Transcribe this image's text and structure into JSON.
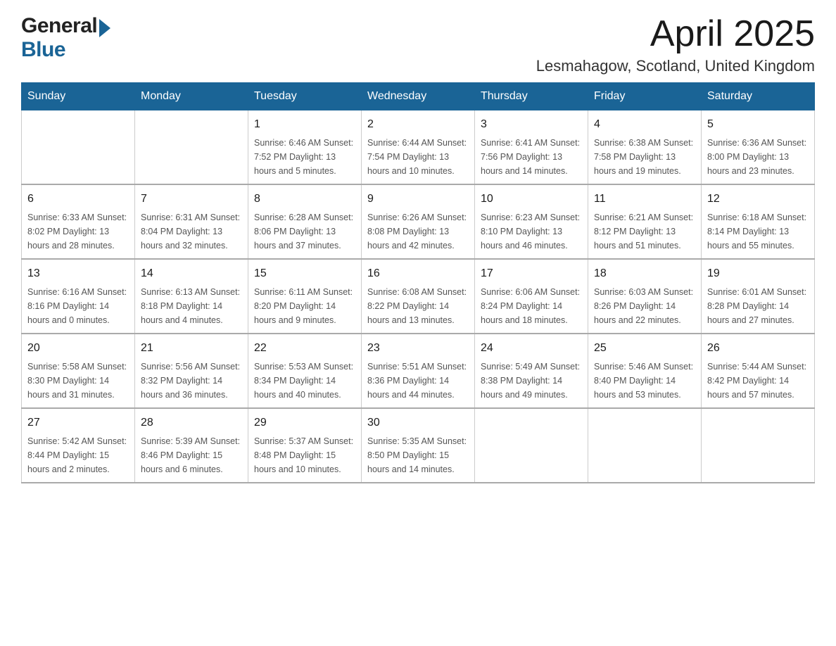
{
  "header": {
    "title": "April 2025",
    "subtitle": "Lesmahagow, Scotland, United Kingdom",
    "logo_general": "General",
    "logo_blue": "Blue"
  },
  "calendar": {
    "days": [
      "Sunday",
      "Monday",
      "Tuesday",
      "Wednesday",
      "Thursday",
      "Friday",
      "Saturday"
    ],
    "weeks": [
      [
        {
          "num": "",
          "info": ""
        },
        {
          "num": "",
          "info": ""
        },
        {
          "num": "1",
          "info": "Sunrise: 6:46 AM\nSunset: 7:52 PM\nDaylight: 13 hours\nand 5 minutes."
        },
        {
          "num": "2",
          "info": "Sunrise: 6:44 AM\nSunset: 7:54 PM\nDaylight: 13 hours\nand 10 minutes."
        },
        {
          "num": "3",
          "info": "Sunrise: 6:41 AM\nSunset: 7:56 PM\nDaylight: 13 hours\nand 14 minutes."
        },
        {
          "num": "4",
          "info": "Sunrise: 6:38 AM\nSunset: 7:58 PM\nDaylight: 13 hours\nand 19 minutes."
        },
        {
          "num": "5",
          "info": "Sunrise: 6:36 AM\nSunset: 8:00 PM\nDaylight: 13 hours\nand 23 minutes."
        }
      ],
      [
        {
          "num": "6",
          "info": "Sunrise: 6:33 AM\nSunset: 8:02 PM\nDaylight: 13 hours\nand 28 minutes."
        },
        {
          "num": "7",
          "info": "Sunrise: 6:31 AM\nSunset: 8:04 PM\nDaylight: 13 hours\nand 32 minutes."
        },
        {
          "num": "8",
          "info": "Sunrise: 6:28 AM\nSunset: 8:06 PM\nDaylight: 13 hours\nand 37 minutes."
        },
        {
          "num": "9",
          "info": "Sunrise: 6:26 AM\nSunset: 8:08 PM\nDaylight: 13 hours\nand 42 minutes."
        },
        {
          "num": "10",
          "info": "Sunrise: 6:23 AM\nSunset: 8:10 PM\nDaylight: 13 hours\nand 46 minutes."
        },
        {
          "num": "11",
          "info": "Sunrise: 6:21 AM\nSunset: 8:12 PM\nDaylight: 13 hours\nand 51 minutes."
        },
        {
          "num": "12",
          "info": "Sunrise: 6:18 AM\nSunset: 8:14 PM\nDaylight: 13 hours\nand 55 minutes."
        }
      ],
      [
        {
          "num": "13",
          "info": "Sunrise: 6:16 AM\nSunset: 8:16 PM\nDaylight: 14 hours\nand 0 minutes."
        },
        {
          "num": "14",
          "info": "Sunrise: 6:13 AM\nSunset: 8:18 PM\nDaylight: 14 hours\nand 4 minutes."
        },
        {
          "num": "15",
          "info": "Sunrise: 6:11 AM\nSunset: 8:20 PM\nDaylight: 14 hours\nand 9 minutes."
        },
        {
          "num": "16",
          "info": "Sunrise: 6:08 AM\nSunset: 8:22 PM\nDaylight: 14 hours\nand 13 minutes."
        },
        {
          "num": "17",
          "info": "Sunrise: 6:06 AM\nSunset: 8:24 PM\nDaylight: 14 hours\nand 18 minutes."
        },
        {
          "num": "18",
          "info": "Sunrise: 6:03 AM\nSunset: 8:26 PM\nDaylight: 14 hours\nand 22 minutes."
        },
        {
          "num": "19",
          "info": "Sunrise: 6:01 AM\nSunset: 8:28 PM\nDaylight: 14 hours\nand 27 minutes."
        }
      ],
      [
        {
          "num": "20",
          "info": "Sunrise: 5:58 AM\nSunset: 8:30 PM\nDaylight: 14 hours\nand 31 minutes."
        },
        {
          "num": "21",
          "info": "Sunrise: 5:56 AM\nSunset: 8:32 PM\nDaylight: 14 hours\nand 36 minutes."
        },
        {
          "num": "22",
          "info": "Sunrise: 5:53 AM\nSunset: 8:34 PM\nDaylight: 14 hours\nand 40 minutes."
        },
        {
          "num": "23",
          "info": "Sunrise: 5:51 AM\nSunset: 8:36 PM\nDaylight: 14 hours\nand 44 minutes."
        },
        {
          "num": "24",
          "info": "Sunrise: 5:49 AM\nSunset: 8:38 PM\nDaylight: 14 hours\nand 49 minutes."
        },
        {
          "num": "25",
          "info": "Sunrise: 5:46 AM\nSunset: 8:40 PM\nDaylight: 14 hours\nand 53 minutes."
        },
        {
          "num": "26",
          "info": "Sunrise: 5:44 AM\nSunset: 8:42 PM\nDaylight: 14 hours\nand 57 minutes."
        }
      ],
      [
        {
          "num": "27",
          "info": "Sunrise: 5:42 AM\nSunset: 8:44 PM\nDaylight: 15 hours\nand 2 minutes."
        },
        {
          "num": "28",
          "info": "Sunrise: 5:39 AM\nSunset: 8:46 PM\nDaylight: 15 hours\nand 6 minutes."
        },
        {
          "num": "29",
          "info": "Sunrise: 5:37 AM\nSunset: 8:48 PM\nDaylight: 15 hours\nand 10 minutes."
        },
        {
          "num": "30",
          "info": "Sunrise: 5:35 AM\nSunset: 8:50 PM\nDaylight: 15 hours\nand 14 minutes."
        },
        {
          "num": "",
          "info": ""
        },
        {
          "num": "",
          "info": ""
        },
        {
          "num": "",
          "info": ""
        }
      ]
    ]
  }
}
